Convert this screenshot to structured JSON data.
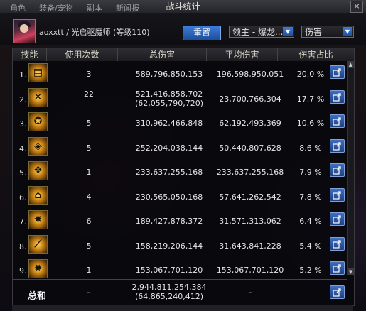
{
  "window": {
    "title": "战斗统计",
    "close_label": "×"
  },
  "background_tabs": [
    "角色",
    "装备/宠物",
    "副本",
    "新闻报"
  ],
  "player": {
    "id": "aoxxtt",
    "info": "aoxxtt / 光启驱魔师 (等级110)"
  },
  "controls": {
    "reset_label": "重置",
    "boss_select": "领主 - 爆龙...",
    "metric_select": "伤害"
  },
  "columns": [
    "技能",
    "使用次数",
    "总伤害",
    "平均伤害",
    "伤害占比"
  ],
  "rows": [
    {
      "rank": "1.",
      "uses": "3",
      "total": "589,796,850,153",
      "total_sub": "",
      "avg": "196,598,950,051",
      "pct": "20.0 %",
      "icon": "skill-scroll-icon"
    },
    {
      "rank": "2.",
      "uses": "22",
      "total": "521,416,858,702",
      "total_sub": "(62,055,790,720)",
      "avg": "23,700,766,304",
      "pct": "17.7 %",
      "icon": "skill-cross-icon"
    },
    {
      "rank": "3.",
      "uses": "5",
      "total": "310,962,466,848",
      "total_sub": "",
      "avg": "62,192,493,369",
      "pct": "10.6 %",
      "icon": "skill-pentagram-icon"
    },
    {
      "rank": "4.",
      "uses": "5",
      "total": "252,204,038,144",
      "total_sub": "",
      "avg": "50,440,807,628",
      "pct": "8.6 %",
      "icon": "skill-seal-icon"
    },
    {
      "rank": "5.",
      "uses": "1",
      "total": "233,637,255,168",
      "total_sub": "",
      "avg": "233,637,255,168",
      "pct": "7.9 %",
      "icon": "skill-dragon-icon"
    },
    {
      "rank": "6.",
      "uses": "4",
      "total": "230,565,050,168",
      "total_sub": "",
      "avg": "57,641,262,542",
      "pct": "7.8 %",
      "icon": "skill-rune-icon"
    },
    {
      "rank": "7.",
      "uses": "6",
      "total": "189,427,878,372",
      "total_sub": "",
      "avg": "31,571,313,062",
      "pct": "6.4 %",
      "icon": "skill-burst-icon"
    },
    {
      "rank": "8.",
      "uses": "5",
      "total": "158,219,206,144",
      "total_sub": "",
      "avg": "31,643,841,228",
      "pct": "5.4 %",
      "icon": "skill-slash-icon"
    },
    {
      "rank": "9.",
      "uses": "1",
      "total": "153,067,701,120",
      "total_sub": "",
      "avg": "153,067,701,120",
      "pct": "5.2 %",
      "icon": "skill-flame-icon"
    }
  ],
  "total": {
    "label": "总和",
    "uses": "–",
    "total": "2,944,811,254,384",
    "total_sub": "(64,865,240,412)",
    "avg": "–"
  },
  "colors": {
    "accent_button": "#2b63b8",
    "header_bg": "#2e2e34"
  }
}
